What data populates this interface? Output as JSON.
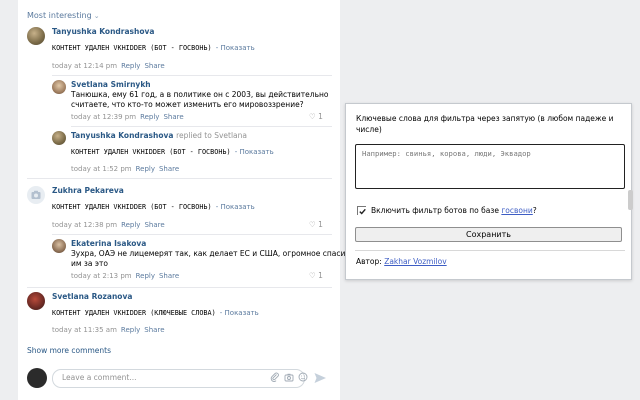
{
  "feed": {
    "sort_label": "Most interesting",
    "comments": [
      {
        "name": "Tanyushka Kondrashova",
        "text": "КОНТЕНТ УДАЛЕН VKHIDDER (БОТ - ГОСВОНЬ)",
        "show": "- Показать",
        "time": "today at 12:14 pm",
        "reply": "Reply",
        "share": "Share"
      },
      {
        "name": "Svetlana Smirnykh",
        "text_lines": [
          "Танюшка, ему 61 год, а в политике он с 2003, вы действительно",
          "считаете, что кто-то может изменить его мировоззрение?"
        ],
        "time": "today at 12:39 pm",
        "reply": "Reply",
        "share": "Share",
        "likes": "1"
      },
      {
        "name": "Tanyushka Kondrashova",
        "replied": "replied to Svetlana",
        "text": "КОНТЕНТ УДАЛЕН VKHIDDER (БОТ - ГОСВОНЬ)",
        "show": "- Показать",
        "time": "today at 1:52 pm",
        "reply": "Reply",
        "share": "Share"
      },
      {
        "name": "Zukhra Pekareva",
        "text": "КОНТЕНТ УДАЛЕН VKHIDDER (БОТ - ГОСВОНЬ)",
        "show": "- Показать",
        "time": "today at 12:38 pm",
        "reply": "Reply",
        "share": "Share",
        "likes": "1"
      },
      {
        "name": "Ekaterina Isakova",
        "text_lines": [
          "Зухра, ОАЭ не лицемерят так, как делает ЕС и США, огромное спасибо",
          "им за это"
        ],
        "time": "today at 2:13 pm",
        "reply": "Reply",
        "share": "Share",
        "likes": "1"
      },
      {
        "name": "Svetlana Rozanova",
        "text": "КОНТЕНТ УДАЛЕН VKHIDDER (КЛЮЧЕВЫЕ СЛОВА)",
        "show": "- Показать",
        "time": "today at 11:35 am",
        "reply": "Reply",
        "share": "Share"
      }
    ],
    "show_more": "Show more comments",
    "composer_placeholder": "Leave a comment..."
  },
  "popup": {
    "keywords_label": "Ключевые слова для фильтра через запятую (в любом падеже и числе)",
    "keywords_placeholder": "Например: свинья, корова, люди, Эквадор",
    "checkbox_checked": true,
    "checkbox_label": "Включить фильтр ботов по базе ",
    "checkbox_link": "госвони",
    "checkbox_suffix": "?",
    "save_label": "Сохранить",
    "author_label": "Автор: ",
    "author_link": "Zakhar Vozmilov"
  },
  "colors": {
    "link": "#2a5885",
    "meta": "#939393",
    "accent_link": "#3d5dc4"
  }
}
